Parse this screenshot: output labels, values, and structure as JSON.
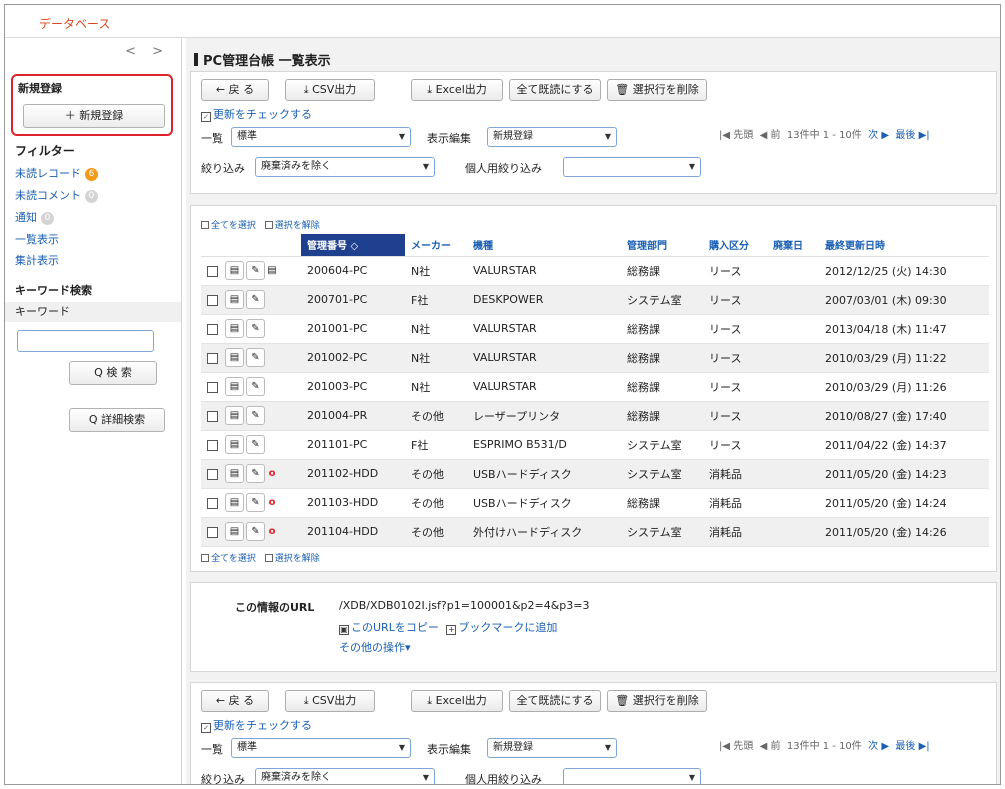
{
  "tab": {
    "label": "データベース"
  },
  "sidebar": {
    "collapse_glyph": "< >",
    "new_section_title": "新規登録",
    "new_button": "＋ 新規登録",
    "filter_title": "フィルター",
    "unread_records": "未読レコード",
    "unread_records_count": "6",
    "unread_comments": "未読コメント",
    "unread_comments_count": "0",
    "notifications": "通知",
    "notifications_count": "0",
    "list_view": "一覧表示",
    "summary_view": "集計表示",
    "keyword_search_title": "キーワード検索",
    "keyword_label": "キーワード",
    "search_button": "Q 検 索",
    "advanced_search_button": "Q 詳細検索"
  },
  "main": {
    "title": "PC管理台帳 一覧表示",
    "toolbar": {
      "back": "← 戻 る",
      "csv": "⤓ CSV出力",
      "excel": "⤓ Excel出力",
      "mark_all_read": "全て既読にする",
      "delete_selected": "🗑 選択行を削除",
      "check_updates": "更新をチェックする",
      "list_label": "一覧",
      "list_value": "標準",
      "display_edit_label": "表示編集",
      "display_edit_value": "新規登録",
      "filter_label": "絞り込み",
      "filter_value": "廃棄済みを除く",
      "personal_filter_label": "個人用絞り込み",
      "personal_filter_value": ""
    },
    "pager": {
      "first": "|◀ 先頭",
      "prev": "◀ 前",
      "status": "13件中 1 - 10件",
      "next": "次 ▶",
      "last": "最後 ▶|"
    },
    "table": {
      "select_all": "全てを選択",
      "deselect": "選択を解除",
      "headers": [
        "管理番号 ◇",
        "メーカー",
        "機種",
        "管理部門",
        "購入区分",
        "廃棄日",
        "最終更新日時"
      ],
      "rows": [
        {
          "mark": "▤",
          "id": "200604-PC",
          "maker": "N社",
          "model": "VALURSTAR",
          "dept": "総務課",
          "purchase": "リース",
          "disposal": "",
          "updated": "2012/12/25 (火) 14:30"
        },
        {
          "mark": "",
          "id": "200701-PC",
          "maker": "F社",
          "model": "DESKPOWER",
          "dept": "システム室",
          "purchase": "リース",
          "disposal": "",
          "updated": "2007/03/01 (木) 09:30"
        },
        {
          "mark": "",
          "id": "201001-PC",
          "maker": "N社",
          "model": "VALURSTAR",
          "dept": "総務課",
          "purchase": "リース",
          "disposal": "",
          "updated": "2013/04/18 (木) 11:47"
        },
        {
          "mark": "",
          "id": "201002-PC",
          "maker": "N社",
          "model": "VALURSTAR",
          "dept": "総務課",
          "purchase": "リース",
          "disposal": "",
          "updated": "2010/03/29 (月) 11:22"
        },
        {
          "mark": "",
          "id": "201003-PC",
          "maker": "N社",
          "model": "VALURSTAR",
          "dept": "総務課",
          "purchase": "リース",
          "disposal": "",
          "updated": "2010/03/29 (月) 11:26"
        },
        {
          "mark": "",
          "id": "201004-PR",
          "maker": "その他",
          "model": "レーザープリンタ",
          "dept": "総務課",
          "purchase": "リース",
          "disposal": "",
          "updated": "2010/08/27 (金) 17:40"
        },
        {
          "mark": "",
          "id": "201101-PC",
          "maker": "F社",
          "model": "ESPRIMO B531/D",
          "dept": "システム室",
          "purchase": "リース",
          "disposal": "",
          "updated": "2011/04/22 (金) 14:37"
        },
        {
          "mark": "o",
          "id": "201102-HDD",
          "maker": "その他",
          "model": "USBハードディスク",
          "dept": "システム室",
          "purchase": "消耗品",
          "disposal": "",
          "updated": "2011/05/20 (金) 14:23"
        },
        {
          "mark": "o",
          "id": "201103-HDD",
          "maker": "その他",
          "model": "USBハードディスク",
          "dept": "総務課",
          "purchase": "消耗品",
          "disposal": "",
          "updated": "2011/05/20 (金) 14:24"
        },
        {
          "mark": "o",
          "id": "201104-HDD",
          "maker": "その他",
          "model": "外付けハードディスク",
          "dept": "システム室",
          "purchase": "消耗品",
          "disposal": "",
          "updated": "2011/05/20 (金) 14:26"
        }
      ]
    },
    "url_info": {
      "label": "この情報のURL",
      "url": "/XDB/XDB0102I.jsf?p1=100001&p2=4&p3=3",
      "copy": "このURLをコピー",
      "bookmark": "ブックマークに追加",
      "other_ops": "その他の操作▾"
    }
  }
}
